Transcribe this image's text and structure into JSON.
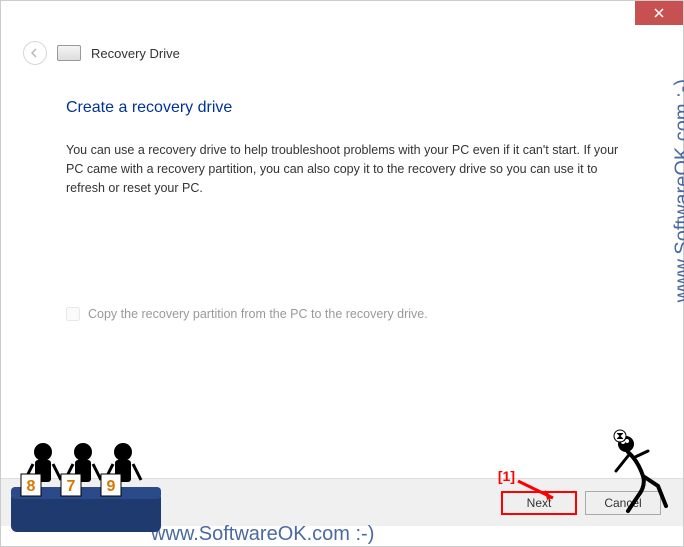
{
  "titlebar": {
    "close": "Close"
  },
  "header": {
    "title": "Recovery Drive"
  },
  "content": {
    "heading": "Create a recovery drive",
    "body": "You can use a recovery drive to help troubleshoot problems with your PC even if it can't start. If your PC came with a recovery partition, you can also copy it to the recovery drive so you can use it to refresh or reset your PC.",
    "checkbox_label": "Copy the recovery partition from the PC to the recovery drive."
  },
  "buttons": {
    "next": "Next",
    "cancel": "Cancel"
  },
  "annotation": {
    "marker1": "[1]"
  },
  "watermark": {
    "text": "www.SoftwareOK.com :-)"
  },
  "judges": {
    "scores": [
      "8",
      "7",
      "9"
    ]
  }
}
